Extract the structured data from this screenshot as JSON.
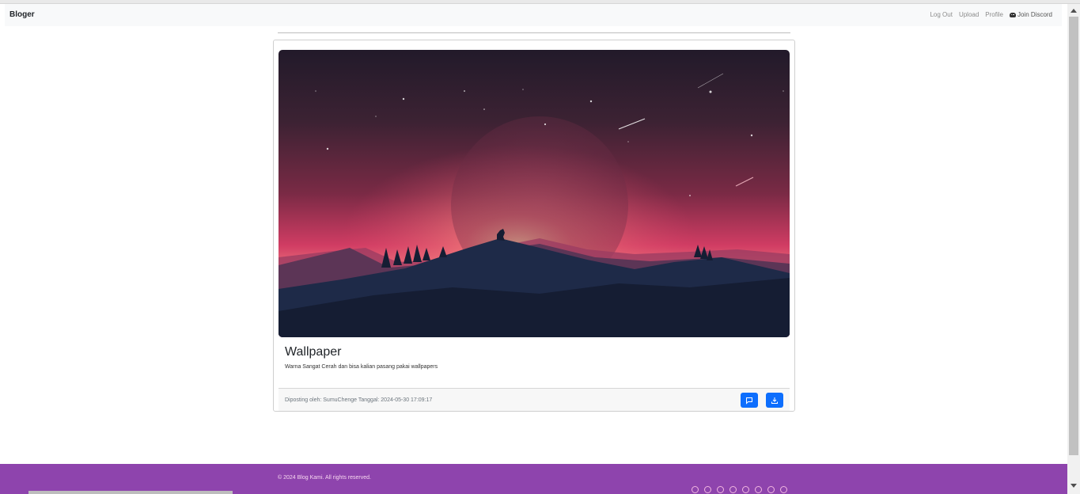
{
  "navbar": {
    "brand": "Bloger",
    "links": [
      "Log Out",
      "Upload",
      "Profile"
    ],
    "discord_label": "Join Discord"
  },
  "post": {
    "image_alt": "Wolf on mountain under large moon at pink sunset",
    "title": "Wallpaper",
    "description": "Warna Sangat Cerah dan bisa kalian pasang pakai wallpapers",
    "meta": "Diposting oleh: SumuChenge Tanggal: 2024-05-30 17:09:17",
    "comment_icon": "comment-icon",
    "download_icon": "download-icon"
  },
  "footer": {
    "copyright": "© 2024 Blog Kami. All rights reserved.",
    "social_icons": [
      "facebook-icon",
      "twitter-icon",
      "instagram-icon",
      "github-icon",
      "linkedin-icon",
      "youtube-icon",
      "pinterest-icon",
      "reddit-icon"
    ]
  },
  "colors": {
    "navbar_bg": "#f8f9fa",
    "button": "#0d6efd",
    "footer_bg": "#8e44ad"
  }
}
